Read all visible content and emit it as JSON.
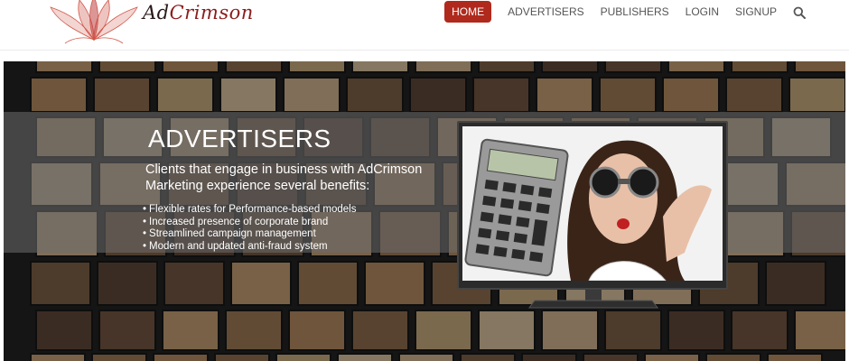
{
  "brand": {
    "name_prefix": "Ad",
    "name_suffix": "Crimson",
    "logo_icon": "lotus-icon"
  },
  "nav": {
    "items": [
      {
        "label": "HOME",
        "active": true
      },
      {
        "label": "ADVERTISERS",
        "active": false
      },
      {
        "label": "PUBLISHERS",
        "active": false
      },
      {
        "label": "LOGIN",
        "active": false
      },
      {
        "label": "SIGNUP",
        "active": false
      }
    ],
    "search_icon": "search-icon"
  },
  "hero": {
    "title": "ADVERTISERS",
    "intro": "Clients that engage in business with AdCrimson Marketing experience several benefits:",
    "benefits": [
      "Flexible rates for Performance-based models",
      "Increased presence of corporate brand",
      "Streamlined campaign management",
      "Modern and updated anti-fraud system"
    ],
    "image": "woman-with-calculator-and-goggles-on-tv-monitor"
  },
  "colors": {
    "accent": "#b0291d",
    "nav_text": "#555555",
    "hero_bg": "#151515",
    "band": "#6e6e6e"
  }
}
